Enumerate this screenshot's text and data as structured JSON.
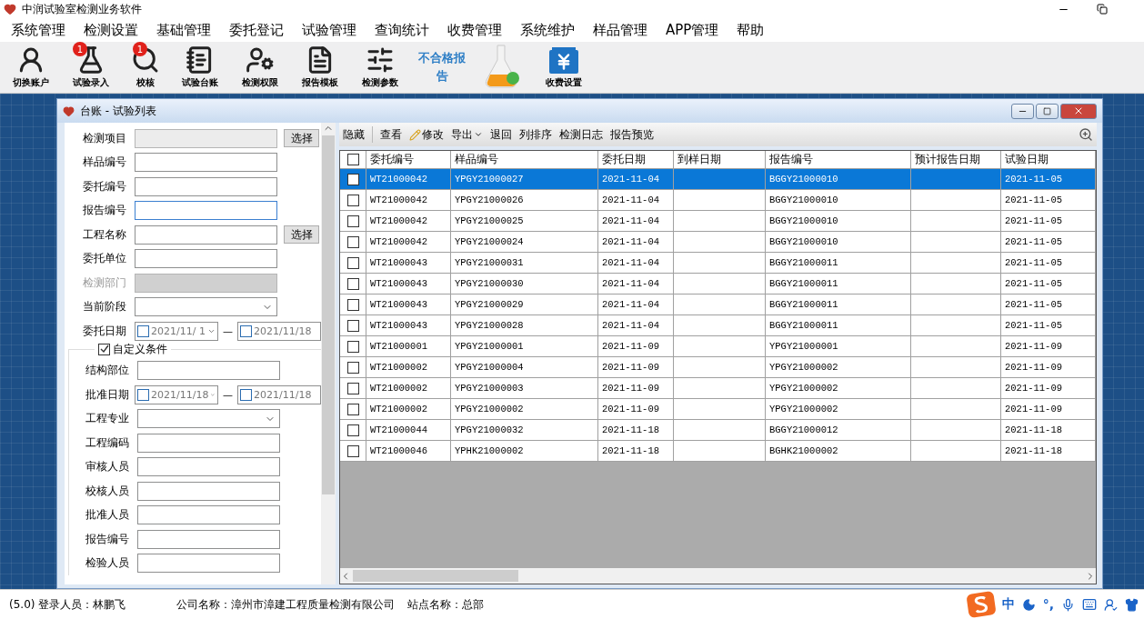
{
  "window": {
    "title": "中润试验室检测业务软件"
  },
  "menu": [
    "系统管理",
    "检测设置",
    "基础管理",
    "委托登记",
    "试验管理",
    "查询统计",
    "收费管理",
    "系统维护",
    "样品管理",
    "APP管理",
    "帮助"
  ],
  "toolbar": [
    {
      "kind": "user",
      "label": "切换账户"
    },
    {
      "kind": "flask",
      "label": "试验录入",
      "badge": "1"
    },
    {
      "kind": "search",
      "label": "校核",
      "badge": "1"
    },
    {
      "kind": "ledger",
      "label": "试验台账"
    },
    {
      "kind": "permission",
      "label": "检测权限"
    },
    {
      "kind": "template",
      "label": "报告模板"
    },
    {
      "kind": "params",
      "label": "检测参数"
    },
    {
      "kind": "text",
      "label": "不合格报告"
    },
    {
      "kind": "flask-image"
    },
    {
      "kind": "fee",
      "label": "收费设置"
    }
  ],
  "child_window": {
    "title": "台账 - 试验列表"
  },
  "filters": [
    {
      "kind": "pick",
      "label": "检测项目",
      "button": "选择",
      "disabled": true
    },
    {
      "kind": "text",
      "label": "样品编号"
    },
    {
      "kind": "text",
      "label": "委托编号"
    },
    {
      "kind": "text",
      "label": "报告编号",
      "focused": true
    },
    {
      "kind": "pick",
      "label": "工程名称",
      "button": "选择",
      "disabled": false
    },
    {
      "kind": "text",
      "label": "委托单位"
    },
    {
      "kind": "select",
      "label": "检测部门",
      "disabled": true
    },
    {
      "kind": "select",
      "label": "当前阶段",
      "disabled": false
    },
    {
      "kind": "daterange",
      "label": "委托日期",
      "from": "2021/11/ 1",
      "to": "2021/11/18",
      "separator": "—"
    }
  ],
  "custom": {
    "label": "自定义条件",
    "checked": true,
    "fields": [
      {
        "kind": "text",
        "label": "结构部位"
      },
      {
        "kind": "daterange",
        "label": "批准日期",
        "from": "2021/11/18",
        "to": "2021/11/18",
        "separator": "—"
      },
      {
        "kind": "select",
        "label": "工程专业"
      },
      {
        "kind": "text",
        "label": "工程编码"
      },
      {
        "kind": "text",
        "label": "审核人员"
      },
      {
        "kind": "text",
        "label": "校核人员"
      },
      {
        "kind": "text",
        "label": "批准人员"
      },
      {
        "kind": "text",
        "label": "报告编号"
      },
      {
        "kind": "text",
        "label": "检验人员"
      }
    ]
  },
  "actions": [
    {
      "kind": "plain",
      "label": "隐藏"
    },
    {
      "kind": "separator"
    },
    {
      "kind": "plain",
      "label": "查看"
    },
    {
      "kind": "edit",
      "label": "修改"
    },
    {
      "kind": "dropdown",
      "label": "导出"
    },
    {
      "kind": "plain",
      "label": "退回"
    },
    {
      "kind": "plain",
      "label": "列排序"
    },
    {
      "kind": "plain",
      "label": "检测日志"
    },
    {
      "kind": "plain",
      "label": "报告预览"
    }
  ],
  "table": {
    "all_checked": false,
    "columns": [
      "委托编号",
      "样品编号",
      "委托日期",
      "到样日期",
      "报告编号",
      "预计报告日期",
      "试验日期"
    ],
    "rows": [
      {
        "selected": true,
        "checked": false,
        "cells": [
          "WT21000042",
          "YPGY21000027",
          "2021-11-04",
          "",
          "BGGY21000010",
          "",
          "2021-11-05"
        ]
      },
      {
        "selected": false,
        "checked": false,
        "cells": [
          "WT21000042",
          "YPGY21000026",
          "2021-11-04",
          "",
          "BGGY21000010",
          "",
          "2021-11-05"
        ]
      },
      {
        "selected": false,
        "checked": false,
        "cells": [
          "WT21000042",
          "YPGY21000025",
          "2021-11-04",
          "",
          "BGGY21000010",
          "",
          "2021-11-05"
        ]
      },
      {
        "selected": false,
        "checked": false,
        "cells": [
          "WT21000042",
          "YPGY21000024",
          "2021-11-04",
          "",
          "BGGY21000010",
          "",
          "2021-11-05"
        ]
      },
      {
        "selected": false,
        "checked": false,
        "cells": [
          "WT21000043",
          "YPGY21000031",
          "2021-11-04",
          "",
          "BGGY21000011",
          "",
          "2021-11-05"
        ]
      },
      {
        "selected": false,
        "checked": false,
        "cells": [
          "WT21000043",
          "YPGY21000030",
          "2021-11-04",
          "",
          "BGGY21000011",
          "",
          "2021-11-05"
        ]
      },
      {
        "selected": false,
        "checked": false,
        "cells": [
          "WT21000043",
          "YPGY21000029",
          "2021-11-04",
          "",
          "BGGY21000011",
          "",
          "2021-11-05"
        ]
      },
      {
        "selected": false,
        "checked": false,
        "cells": [
          "WT21000043",
          "YPGY21000028",
          "2021-11-04",
          "",
          "BGGY21000011",
          "",
          "2021-11-05"
        ]
      },
      {
        "selected": false,
        "checked": false,
        "cells": [
          "WT21000001",
          "YPGY21000001",
          "2021-11-09",
          "",
          "YPGY21000001",
          "",
          "2021-11-09"
        ]
      },
      {
        "selected": false,
        "checked": false,
        "cells": [
          "WT21000002",
          "YPGY21000004",
          "2021-11-09",
          "",
          "YPGY21000002",
          "",
          "2021-11-09"
        ]
      },
      {
        "selected": false,
        "checked": false,
        "cells": [
          "WT21000002",
          "YPGY21000003",
          "2021-11-09",
          "",
          "YPGY21000002",
          "",
          "2021-11-09"
        ]
      },
      {
        "selected": false,
        "checked": false,
        "cells": [
          "WT21000002",
          "YPGY21000002",
          "2021-11-09",
          "",
          "YPGY21000002",
          "",
          "2021-11-09"
        ]
      },
      {
        "selected": false,
        "checked": false,
        "cells": [
          "WT21000044",
          "YPGY21000032",
          "2021-11-18",
          "",
          "BGGY21000012",
          "",
          "2021-11-18"
        ]
      },
      {
        "selected": false,
        "checked": false,
        "cells": [
          "WT21000046",
          "YPHK21000002",
          "2021-11-18",
          "",
          "BGHK21000002",
          "",
          "2021-11-18"
        ]
      }
    ]
  },
  "status_bar": {
    "user": "(5.0) 登录人员：林鹏飞",
    "company": "公司名称：漳州市漳建工程质量检测有限公司",
    "site": "站点名称：总部"
  },
  "ime": {
    "mode": "中",
    "punct": "°,"
  }
}
